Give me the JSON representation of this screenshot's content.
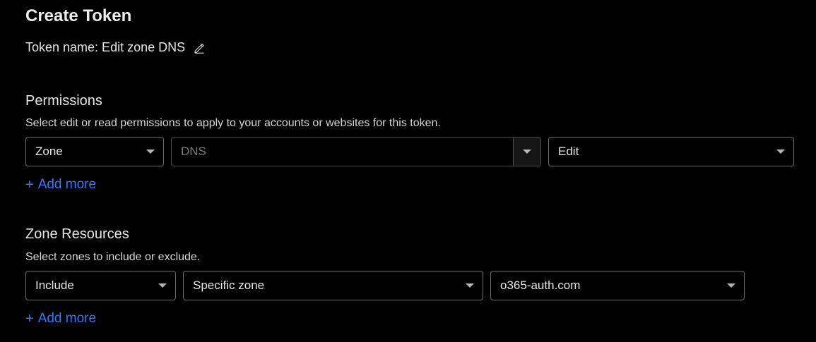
{
  "page": {
    "title": "Create Token",
    "token_name_label": "Token name: Edit zone DNS"
  },
  "permissions": {
    "heading": "Permissions",
    "description": "Select edit or read permissions to apply to your accounts or websites for this token.",
    "selects": {
      "scope": "Zone",
      "resource": "DNS",
      "access": "Edit"
    },
    "add_more_plus": "+",
    "add_more_label": "Add more"
  },
  "zone_resources": {
    "heading": "Zone Resources",
    "description": "Select zones to include or exclude.",
    "selects": {
      "mode": "Include",
      "target": "Specific zone",
      "zone": "o365-auth.com"
    },
    "add_more_plus": "+",
    "add_more_label": "Add more"
  },
  "colors": {
    "background": "#000000",
    "link": "#2f7bff",
    "border": "#6b6b6b"
  },
  "icons": {
    "edit": "pencil-icon",
    "dropdown": "chevron-down-icon"
  }
}
